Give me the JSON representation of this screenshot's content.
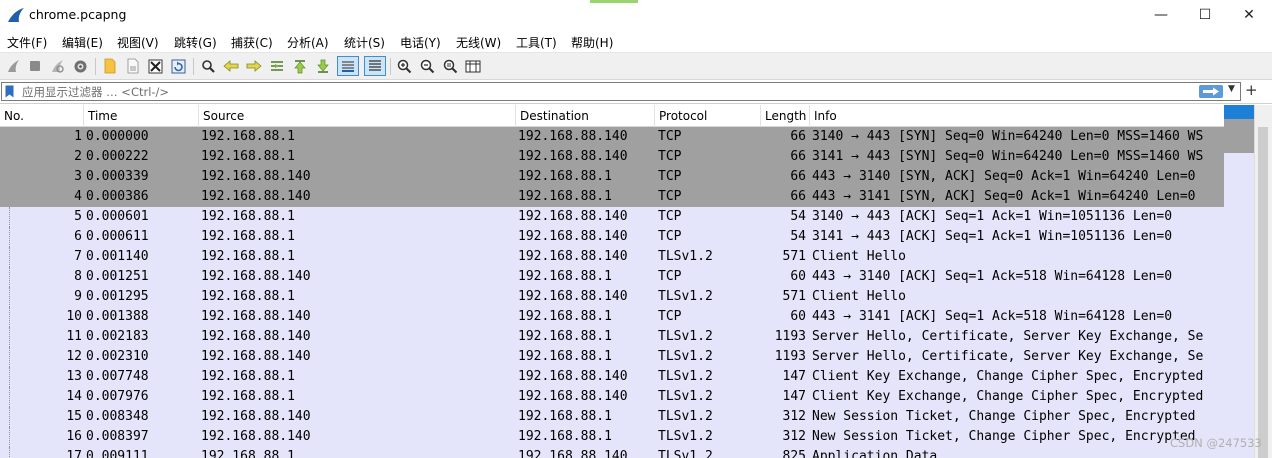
{
  "window": {
    "title": "chrome.pcapng",
    "controls": {
      "minimize": "—",
      "maximize": "☐",
      "close": "✕"
    }
  },
  "menu": [
    {
      "label": "文件(F)"
    },
    {
      "label": "编辑(E)"
    },
    {
      "label": "视图(V)"
    },
    {
      "label": "跳转(G)"
    },
    {
      "label": "捕获(C)"
    },
    {
      "label": "分析(A)"
    },
    {
      "label": "统计(S)"
    },
    {
      "label": "电话(Y)"
    },
    {
      "label": "无线(W)"
    },
    {
      "label": "工具(T)"
    },
    {
      "label": "帮助(H)"
    }
  ],
  "toolbar": {
    "icons": [
      "start-capture-icon",
      "stop-capture-icon",
      "restart-capture-icon",
      "capture-options-icon",
      "open-file-icon",
      "save-file-icon",
      "close-file-icon",
      "reload-file-icon",
      "find-packet-icon",
      "go-back-icon",
      "go-forward-icon",
      "go-to-packet-icon",
      "first-packet-icon",
      "last-packet-icon",
      "auto-scroll-icon",
      "colorize-icon",
      "zoom-in-icon",
      "zoom-out-icon",
      "normal-size-icon",
      "resize-columns-icon"
    ]
  },
  "filter": {
    "placeholder": "应用显示过滤器 … <Ctrl-/>",
    "value": ""
  },
  "packet_list": {
    "columns": [
      "No.",
      "Time",
      "Source",
      "Destination",
      "Protocol",
      "Length",
      "Info"
    ],
    "colors": {
      "selected_bg": "#a0a0a0",
      "row_bg": "#e4e4fa",
      "scroll_accent": "#1e7fd6"
    },
    "rows": [
      {
        "no": "1",
        "time": "0.000000",
        "src": "192.168.88.1",
        "dst": "192.168.88.140",
        "proto": "TCP",
        "len": "66",
        "info": "3140 → 443 [SYN] Seq=0 Win=64240 Len=0 MSS=1460 WS",
        "selected": true
      },
      {
        "no": "2",
        "time": "0.000222",
        "src": "192.168.88.1",
        "dst": "192.168.88.140",
        "proto": "TCP",
        "len": "66",
        "info": "3141 → 443 [SYN] Seq=0 Win=64240 Len=0 MSS=1460 WS",
        "selected": true
      },
      {
        "no": "3",
        "time": "0.000339",
        "src": "192.168.88.140",
        "dst": "192.168.88.1",
        "proto": "TCP",
        "len": "66",
        "info": "443 → 3140 [SYN, ACK] Seq=0 Ack=1 Win=64240 Len=0",
        "selected": true
      },
      {
        "no": "4",
        "time": "0.000386",
        "src": "192.168.88.140",
        "dst": "192.168.88.1",
        "proto": "TCP",
        "len": "66",
        "info": "443 → 3141 [SYN, ACK] Seq=0 Ack=1 Win=64240 Len=0",
        "selected": true
      },
      {
        "no": "5",
        "time": "0.000601",
        "src": "192.168.88.1",
        "dst": "192.168.88.140",
        "proto": "TCP",
        "len": "54",
        "info": "3140 → 443 [ACK] Seq=1 Ack=1 Win=1051136 Len=0",
        "selected": false
      },
      {
        "no": "6",
        "time": "0.000611",
        "src": "192.168.88.1",
        "dst": "192.168.88.140",
        "proto": "TCP",
        "len": "54",
        "info": "3141 → 443 [ACK] Seq=1 Ack=1 Win=1051136 Len=0",
        "selected": false
      },
      {
        "no": "7",
        "time": "0.001140",
        "src": "192.168.88.1",
        "dst": "192.168.88.140",
        "proto": "TLSv1.2",
        "len": "571",
        "info": "Client Hello",
        "selected": false
      },
      {
        "no": "8",
        "time": "0.001251",
        "src": "192.168.88.140",
        "dst": "192.168.88.1",
        "proto": "TCP",
        "len": "60",
        "info": "443 → 3140 [ACK] Seq=1 Ack=518 Win=64128 Len=0",
        "selected": false
      },
      {
        "no": "9",
        "time": "0.001295",
        "src": "192.168.88.1",
        "dst": "192.168.88.140",
        "proto": "TLSv1.2",
        "len": "571",
        "info": "Client Hello",
        "selected": false
      },
      {
        "no": "10",
        "time": "0.001388",
        "src": "192.168.88.140",
        "dst": "192.168.88.1",
        "proto": "TCP",
        "len": "60",
        "info": "443 → 3141 [ACK] Seq=1 Ack=518 Win=64128 Len=0",
        "selected": false
      },
      {
        "no": "11",
        "time": "0.002183",
        "src": "192.168.88.140",
        "dst": "192.168.88.1",
        "proto": "TLSv1.2",
        "len": "1193",
        "info": "Server Hello, Certificate, Server Key Exchange, Se",
        "selected": false
      },
      {
        "no": "12",
        "time": "0.002310",
        "src": "192.168.88.140",
        "dst": "192.168.88.1",
        "proto": "TLSv1.2",
        "len": "1193",
        "info": "Server Hello, Certificate, Server Key Exchange, Se",
        "selected": false
      },
      {
        "no": "13",
        "time": "0.007748",
        "src": "192.168.88.1",
        "dst": "192.168.88.140",
        "proto": "TLSv1.2",
        "len": "147",
        "info": "Client Key Exchange, Change Cipher Spec, Encrypted",
        "selected": false
      },
      {
        "no": "14",
        "time": "0.007976",
        "src": "192.168.88.1",
        "dst": "192.168.88.140",
        "proto": "TLSv1.2",
        "len": "147",
        "info": "Client Key Exchange, Change Cipher Spec, Encrypted",
        "selected": false
      },
      {
        "no": "15",
        "time": "0.008348",
        "src": "192.168.88.140",
        "dst": "192.168.88.1",
        "proto": "TLSv1.2",
        "len": "312",
        "info": "New Session Ticket, Change Cipher Spec, Encrypted",
        "selected": false
      },
      {
        "no": "16",
        "time": "0.008397",
        "src": "192.168.88.140",
        "dst": "192.168.88.1",
        "proto": "TLSv1.2",
        "len": "312",
        "info": "New Session Ticket, Change Cipher Spec, Encrypted",
        "selected": false
      },
      {
        "no": "17",
        "time": "0.009111",
        "src": "192.168.88.1",
        "dst": "192.168.88.140",
        "proto": "TLSv1.2",
        "len": "825",
        "info": "Application Data",
        "selected": false
      }
    ]
  },
  "watermark": "CSDN @247533"
}
